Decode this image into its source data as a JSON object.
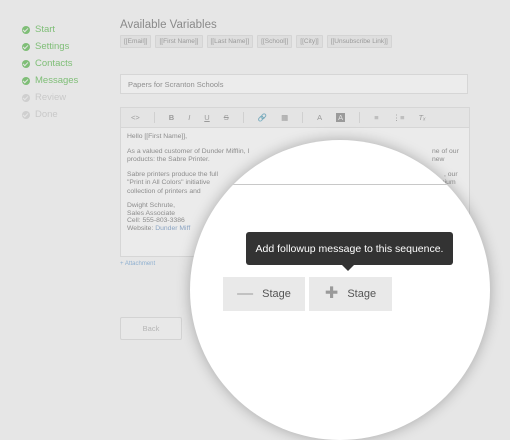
{
  "steps": [
    {
      "label": "Start",
      "state": "done"
    },
    {
      "label": "Settings",
      "state": "done"
    },
    {
      "label": "Contacts",
      "state": "done"
    },
    {
      "label": "Messages",
      "state": "done"
    },
    {
      "label": "Review",
      "state": "pending"
    },
    {
      "label": "Done",
      "state": "pending"
    }
  ],
  "variables": {
    "title": "Available Variables",
    "tags": [
      "[[Email]]",
      "[[First Name]]",
      "[[Last Name]]",
      "[[School]]",
      "[[City]]",
      "[[Unsubscribe Link]]"
    ]
  },
  "subject": {
    "value": "Papers for Scranton Schools"
  },
  "editor": {
    "toolbar": [
      "<>",
      "B",
      "I",
      "U",
      "S",
      "link-icon",
      "image-icon",
      "A",
      "highlight-icon",
      "align-icon",
      "list-icon",
      "clear-format-icon"
    ],
    "greeting": "Hello [[First Name]],",
    "para1": "As a valued customer of Dunder Mifflin, I",
    "para1_end": "ne of our new",
    "para1_line2": "products: the Sabre Printer.",
    "para2": "Sabre printers produce the full",
    "para2_b": "\"Print in All Colors\" initiative",
    "para2_c": "collection of printers and",
    "para2_end1": ", our",
    "para2_end2": "mium",
    "sig_name": "Dwight Schrute,",
    "sig_title": "Sales Associate",
    "sig_cell": "Cell: 555-803-3386",
    "sig_web_label": "Website:",
    "sig_web_link": "Dunder Miff"
  },
  "attachment_label": "+ Attachment",
  "back_label": "Back",
  "lens": {
    "tooltip": "Add followup message to this sequence.",
    "remove_stage": "Stage",
    "add_stage": "Stage"
  },
  "colors": {
    "step_done": "#7fbe77",
    "tooltip_bg": "#333333",
    "accent": "#8fb6cf"
  }
}
